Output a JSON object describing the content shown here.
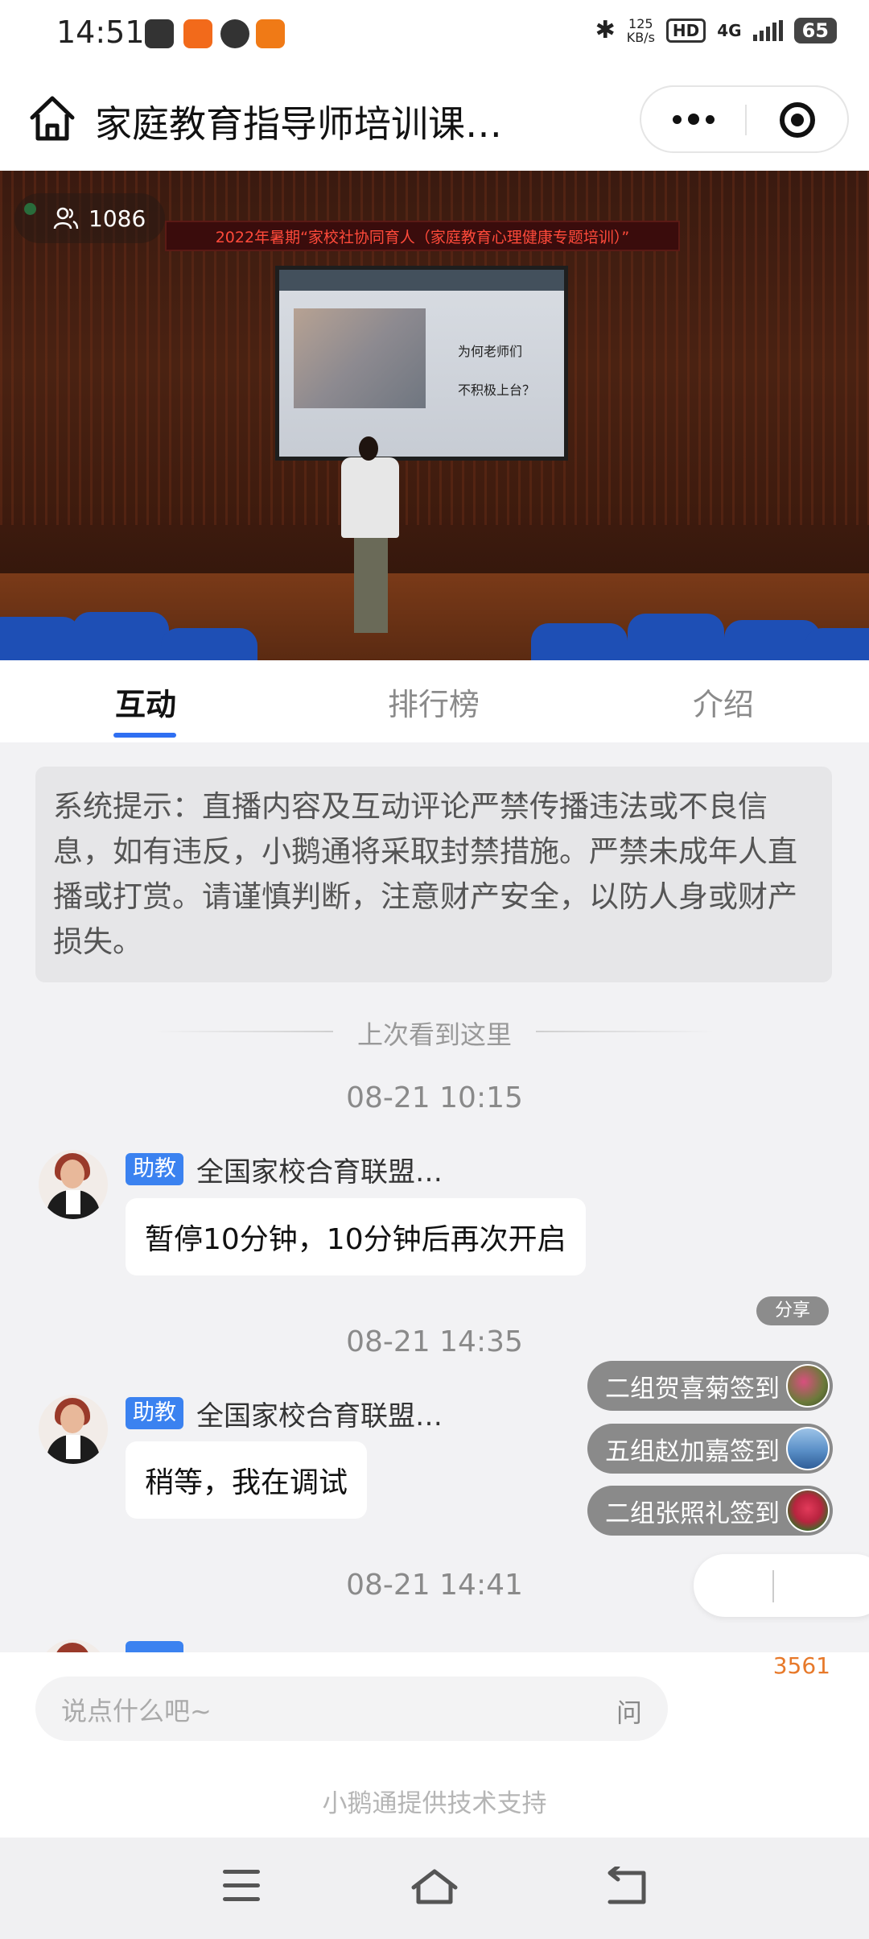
{
  "status_bar": {
    "time": "14:51",
    "net_speed_value": "125",
    "net_speed_unit": "KB/s",
    "hd": "HD",
    "network": "4G",
    "battery": "65"
  },
  "header": {
    "title": "家庭教育指导师培训课…"
  },
  "video": {
    "viewer_count": "1086",
    "banner_text": "2022年暑期“家校社协同育人（家庭教育心理健康专题培训）”",
    "screen_line1": "为何老师们",
    "screen_line2": "不积极上台？"
  },
  "tabs": [
    {
      "label": "互动"
    },
    {
      "label": "排行榜"
    },
    {
      "label": "介绍"
    }
  ],
  "notice": {
    "text": "系统提示：直播内容及互动评论严禁传播违法或不良信息，如有违反，小鹅通将采取封禁措施。严禁未成年人直播或打赏。请谨慎判断，注意财产安全，以防人身或财产损失。"
  },
  "last_seen": "上次看到这里",
  "messages": [
    {
      "time": "08-21 10:15",
      "role": "助教",
      "sender": "全国家校合育联盟…",
      "text": "暂停10分钟，10分钟后再次开启"
    },
    {
      "time": "08-21 14:35",
      "role": "助教",
      "sender": "全国家校合育联盟…",
      "text": "稍等，我在调试"
    },
    {
      "time": "08-21 14:41"
    }
  ],
  "share_label": "分享",
  "checkins": [
    {
      "text": "二组贺喜菊签到"
    },
    {
      "text": "五组赵加嘉签到"
    },
    {
      "text": "二组张照礼签到"
    }
  ],
  "input": {
    "count": "3561",
    "placeholder": "说点什么吧~",
    "ask_label": "问"
  },
  "powered_by": "小鹅通提供技术支持",
  "colors": {
    "accent_blue": "#2f6ff2",
    "role_tag_blue": "#3b82f0",
    "count_orange": "#e7792a",
    "live_green": "#2bd16a"
  }
}
